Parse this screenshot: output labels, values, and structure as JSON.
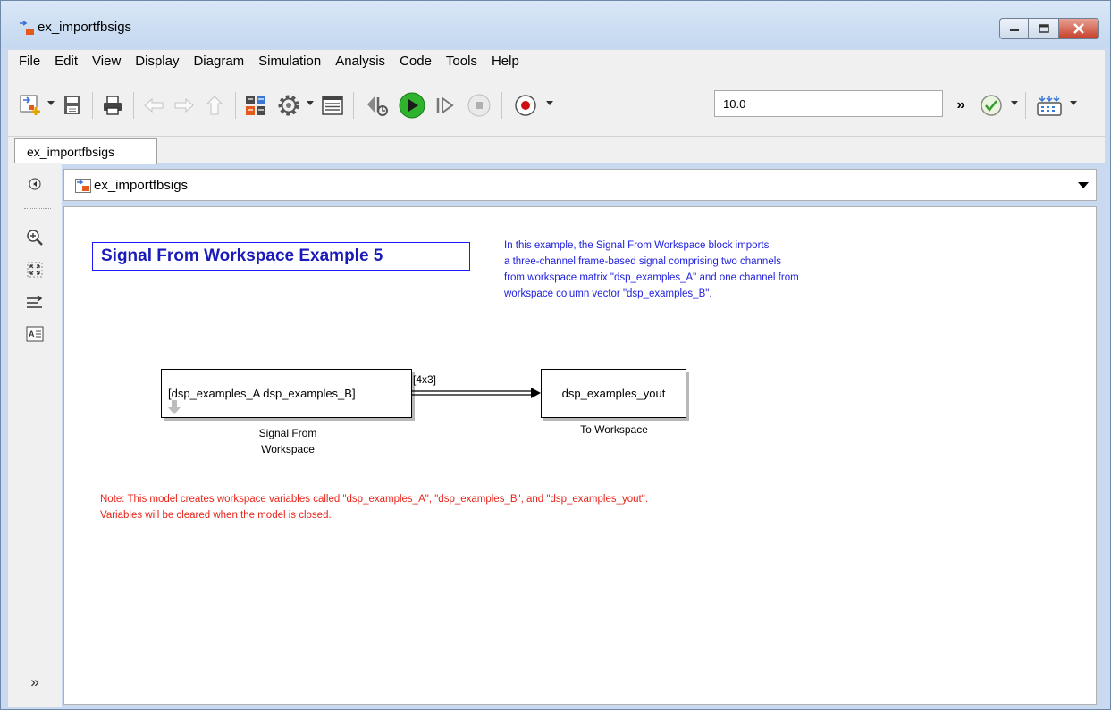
{
  "window": {
    "title": "ex_importfbsigs",
    "controls": {
      "minimize_icon": "minimize-icon",
      "maximize_icon": "maximize-icon",
      "close_icon": "close-icon"
    }
  },
  "menu": [
    "File",
    "Edit",
    "View",
    "Display",
    "Diagram",
    "Simulation",
    "Analysis",
    "Code",
    "Tools",
    "Help"
  ],
  "toolbar": {
    "stop_time": "10.0",
    "more_label": "»"
  },
  "tabs": [
    {
      "label": "ex_importfbsigs"
    }
  ],
  "address": {
    "path": "ex_importfbsigs"
  },
  "palette": {
    "expand_label": "»"
  },
  "canvas": {
    "title": "Signal From Workspace Example 5",
    "description": "In this example, the Signal From Workspace block imports\na three-channel frame-based signal comprising two channels\nfrom workspace matrix \"dsp_examples_A\" and one channel from\nworkspace column vector \"dsp_examples_B\".",
    "blocks": {
      "source": {
        "content": "[dsp_examples_A dsp_examples_B]",
        "label": "Signal From\nWorkspace"
      },
      "sink": {
        "content": "dsp_examples_yout",
        "label": "To Workspace"
      }
    },
    "signal_label": "[4x3]",
    "note": "Note: This model creates workspace variables called \"dsp_examples_A\", \"dsp_examples_B\", and \"dsp_examples_yout\".\nVariables will be cleared when the model is closed."
  },
  "colors": {
    "title_text": "#1a1ab8",
    "description_text": "#2020e0",
    "note_text": "#e8241a",
    "run_button": "#2fb32f",
    "record_button": "#d01010"
  }
}
